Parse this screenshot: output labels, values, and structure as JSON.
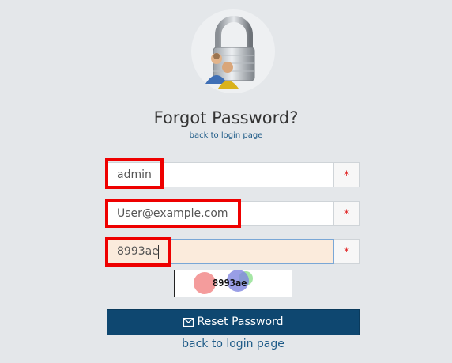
{
  "header": {
    "title": "Forgot Password?",
    "back_link": "back to login page"
  },
  "form": {
    "username": {
      "value": "admin",
      "icon": "required-asterisk",
      "required_mark": "*"
    },
    "email": {
      "value": "User@example.com",
      "required_mark": "*"
    },
    "captcha_input": {
      "value": "8993ae",
      "required_mark": "*"
    },
    "captcha_image_text": "8993ae"
  },
  "actions": {
    "reset_label": "Reset Password",
    "reset_icon": "envelope-icon",
    "back_link": "back to login page"
  },
  "colors": {
    "background": "#e4e7ea",
    "button": "#0e4770",
    "link": "#1d5a87",
    "highlight": "#ee0000",
    "active_field": "#fbebdc"
  }
}
